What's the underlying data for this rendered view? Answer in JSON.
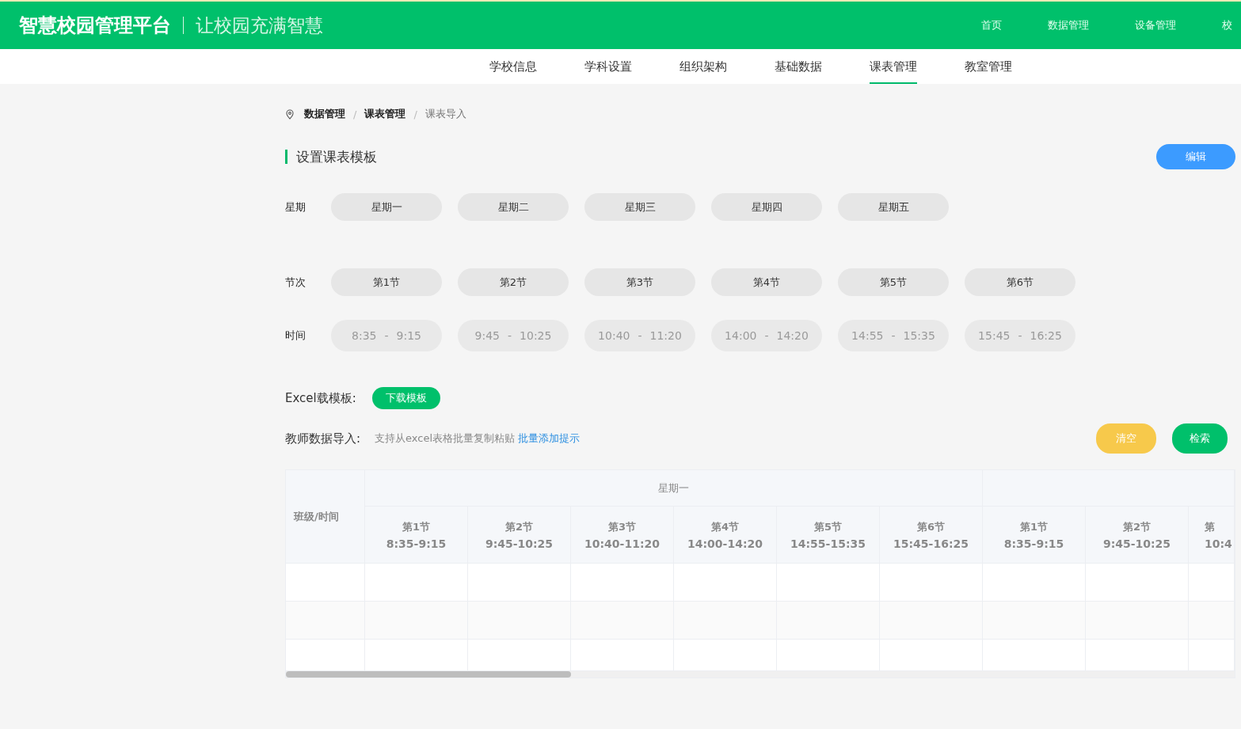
{
  "header": {
    "title": "智慧校园管理平台",
    "slogan": "让校园充满智慧",
    "nav": [
      {
        "label": "首页",
        "selected": false
      },
      {
        "label": "数据管理",
        "selected": false
      },
      {
        "label": "设备管理",
        "selected": false
      },
      {
        "label": "校",
        "selected": false
      }
    ]
  },
  "subnav": [
    {
      "label": "学校信息",
      "selected": false
    },
    {
      "label": "学科设置",
      "selected": false
    },
    {
      "label": "组织架构",
      "selected": false
    },
    {
      "label": "基础数据",
      "selected": false
    },
    {
      "label": "课表管理",
      "selected": true
    },
    {
      "label": "教室管理",
      "selected": false
    }
  ],
  "breadcrumb": [
    {
      "label": "数据管理",
      "current": false
    },
    {
      "label": "课表管理",
      "current": false
    },
    {
      "label": "课表导入",
      "current": true
    }
  ],
  "breadcrumb_separators": [
    "/",
    "/"
  ],
  "section": {
    "title": "设置课表模板",
    "edit_button": "编辑"
  },
  "weekdays": {
    "label": "星期",
    "items": [
      "星期一",
      "星期二",
      "星期三",
      "星期四",
      "星期五"
    ]
  },
  "periods": {
    "label": "节次",
    "items": [
      "第1节",
      "第2节",
      "第3节",
      "第4节",
      "第5节",
      "第6节"
    ]
  },
  "times": {
    "label": "时间",
    "items": [
      {
        "start": "8:35",
        "separator": "-",
        "end": "9:15",
        "disabled": true
      },
      {
        "start": "9:45",
        "separator": "-",
        "end": "10:25",
        "disabled": true
      },
      {
        "start": "10:40",
        "separator": "-",
        "end": "11:20",
        "disabled": true
      },
      {
        "start": "14:00",
        "separator": "-",
        "end": "14:20",
        "disabled": true
      },
      {
        "start": "14:55",
        "separator": "-",
        "end": "15:35",
        "disabled": true
      },
      {
        "start": "15:45",
        "separator": "-",
        "end": "16:25",
        "disabled": true
      }
    ]
  },
  "excel": {
    "label": "Excel载模板:",
    "button": "下载模板"
  },
  "import": {
    "label": "教师数据导入:",
    "hint": "支持从excel表格批量复制粘贴",
    "link": "批量添加提示",
    "clear_button": "清空",
    "search_button": "检索"
  },
  "table": {
    "corner": "班级/时间",
    "groups": [
      {
        "label": "星期一"
      }
    ],
    "columns": [
      {
        "period": "第1节",
        "time": "8:35-9:15"
      },
      {
        "period": "第2节",
        "time": "9:45-10:25"
      },
      {
        "period": "第3节",
        "time": "10:40-11:20"
      },
      {
        "period": "第4节",
        "time": "14:00-14:20"
      },
      {
        "period": "第5节",
        "time": "14:55-15:35"
      },
      {
        "period": "第6节",
        "time": "15:45-16:25"
      },
      {
        "period": "第1节",
        "time": "8:35-9:15"
      },
      {
        "period": "第2节",
        "time": "9:45-10:25"
      },
      {
        "period": "第",
        "time": "10:4"
      }
    ]
  }
}
